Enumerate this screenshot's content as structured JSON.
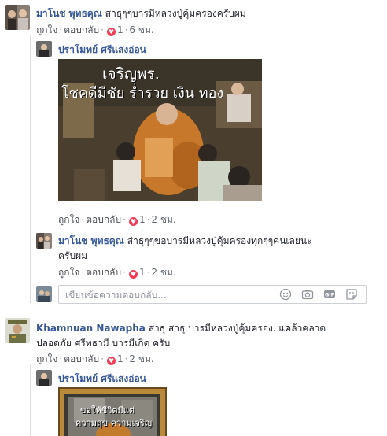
{
  "comments": [
    {
      "author": "มาโนช พุทธคุณ",
      "text": "สาธุๆๆบารมีหลวงปู่คุ้มครองครับผม",
      "meta": {
        "like": "ถูกใจ",
        "reply": "ตอบกลับ",
        "reactions": "1",
        "time": "6 ชม."
      }
    },
    {
      "author": "ปราโมทย์ ศรีแสงอ่อน",
      "image_text": {
        "line1": "เจริญพร.",
        "line2": "โชคดีมีชัย ร่ำรวย เงิน ทอง"
      },
      "meta": {
        "like": "ถูกใจ",
        "reply": "ตอบกลับ",
        "reactions": "1",
        "time": "2 ชม."
      }
    },
    {
      "author": "มาโนช พุทธคุณ",
      "text_line1": "ส่าธุๆๆขอบารมีหลวงปู่คุ้มครองทุกๆๆคนเลยนะ",
      "text_line2": "ครับผม",
      "meta": {
        "like": "ถูกใจ",
        "reply": "ตอบกลับ",
        "reactions": "1",
        "time": "2 ชม."
      }
    },
    {
      "author": "Khamnuan Nawapha",
      "text_line1": "สาธุ สาธุ บารมีหลวงปู่คุ้มครอง. แคล้วคลาด",
      "text_line2": "ปลอดภัย ศรีทธามี บารมีเกิด ครับ",
      "meta": {
        "like": "ถูกใจ",
        "reply": "ตอบกลับ",
        "reactions": "1",
        "time": "2 ชม."
      }
    },
    {
      "author": "ปราโมทย์ ศรีแสงอ่อน",
      "image_text": {
        "line1": "ขอให้ชีวิตมีแต่",
        "line2": "ความสุข ความเจริญ"
      }
    }
  ],
  "reply_box": {
    "placeholder": "เขียนข้อความตอบกลับ..."
  },
  "colors": {
    "link": "#365899",
    "heart": "#f33e58",
    "meta": "#616770"
  }
}
